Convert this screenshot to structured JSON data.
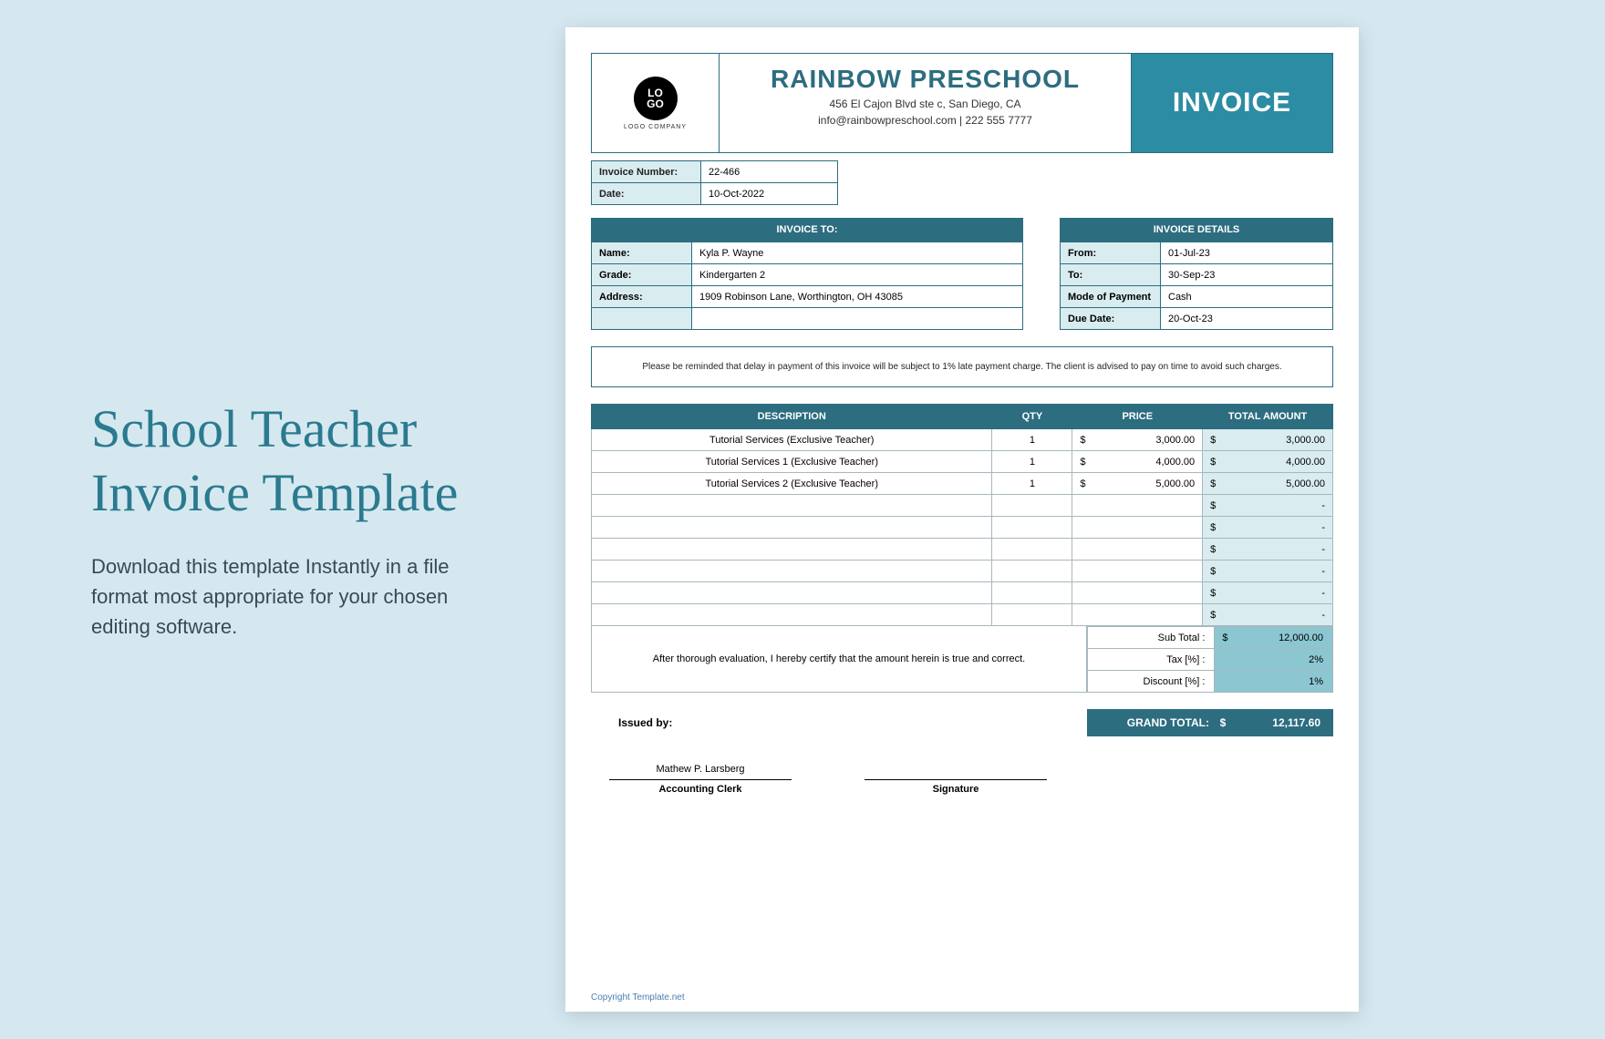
{
  "left": {
    "title_line1": "School Teacher",
    "title_line2": "Invoice Template",
    "description": "Download this template Instantly in a file format most appropriate for your chosen editing software."
  },
  "header": {
    "logo_text": "LO\nGO",
    "logo_sub": "LOGO COMPANY",
    "school_name": "RAINBOW PRESCHOOL",
    "address": "456 El Cajon Blvd ste c, San Diego, CA",
    "contact": "info@rainbowpreschool.com | 222 555 7777",
    "invoice_badge": "INVOICE"
  },
  "meta": {
    "invoice_number_label": "Invoice Number:",
    "invoice_number": "22-466",
    "date_label": "Date:",
    "date": "10-Oct-2022"
  },
  "invoice_to": {
    "header": "INVOICE TO:",
    "name_label": "Name:",
    "name": "Kyla P. Wayne",
    "grade_label": "Grade:",
    "grade": "Kindergarten 2",
    "address_label": "Address:",
    "address": "1909  Robinson Lane, Worthington, OH 43085"
  },
  "details": {
    "header": "INVOICE DETAILS",
    "from_label": "From:",
    "from": "01-Jul-23",
    "to_label": "To:",
    "to": "30-Sep-23",
    "mode_label": "Mode of Payment",
    "mode": "Cash",
    "due_label": "Due Date:",
    "due": "20-Oct-23"
  },
  "notice": "Please be reminded that delay in payment of this invoice will be subject to 1% late payment charge. The client is advised to pay on time to avoid such charges.",
  "columns": {
    "description": "DESCRIPTION",
    "qty": "QTY",
    "price": "PRICE",
    "total": "TOTAL AMOUNT"
  },
  "items": [
    {
      "desc": "Tutorial Services (Exclusive Teacher)",
      "qty": "1",
      "price": "3,000.00",
      "total": "3,000.00"
    },
    {
      "desc": "Tutorial Services 1 (Exclusive Teacher)",
      "qty": "1",
      "price": "4,000.00",
      "total": "4,000.00"
    },
    {
      "desc": "Tutorial Services 2 (Exclusive Teacher)",
      "qty": "1",
      "price": "5,000.00",
      "total": "5,000.00"
    },
    {
      "desc": "",
      "qty": "",
      "price": "",
      "total": "-"
    },
    {
      "desc": "",
      "qty": "",
      "price": "",
      "total": "-"
    },
    {
      "desc": "",
      "qty": "",
      "price": "",
      "total": "-"
    },
    {
      "desc": "",
      "qty": "",
      "price": "",
      "total": "-"
    },
    {
      "desc": "",
      "qty": "",
      "price": "",
      "total": "-"
    },
    {
      "desc": "",
      "qty": "",
      "price": "",
      "total": "-"
    }
  ],
  "certification": "After thorough evaluation, I hereby certify that the amount herein is true and correct.",
  "summary": {
    "subtotal_label": "Sub Total :",
    "subtotal": "12,000.00",
    "tax_label": "Tax [%] :",
    "tax": "2%",
    "discount_label": "Discount [%] :",
    "discount": "1%"
  },
  "grand": {
    "issued_label": "Issued by:",
    "total_label": "GRAND TOTAL:",
    "currency": "$",
    "value": "12,117.60"
  },
  "signatures": {
    "name": "Mathew P. Larsberg",
    "role1": "Accounting Clerk",
    "role2": "Signature"
  },
  "copyright": "Copyright Template.net"
}
